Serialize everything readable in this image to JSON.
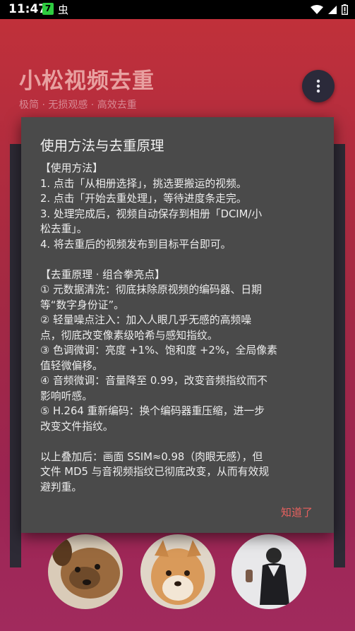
{
  "status_bar": {
    "time": "11:47",
    "badge": "7",
    "glyph": "虫"
  },
  "app": {
    "title": "小松视频去重",
    "subtitle": "极简 · 无损观感 · 高效去重"
  },
  "dialog": {
    "title": "使用方法与去重原理",
    "lines": [
      "【使用方法】",
      "1. 点击「从相册选择」，挑选要搬运的视频。",
      "2. 点击「开始去重处理」，等待进度条走完。",
      "3. 处理完成后，视频自动保存到相册「DCIM/小",
      "松去重」。",
      "4. 将去重后的视频发布到目标平台即可。",
      "",
      "【去重原理 · 组合拳亮点】",
      "① 元数据清洗：彻底抹除原视频的编码器、日期",
      "等“数字身份证”。",
      "② 轻量噪点注入：加入人眼几乎无感的高频噪",
      "点，彻底改变像素级哈希与感知指纹。",
      "③ 色调微调：亮度 +1%、饱和度 +2%，全局像素",
      "值轻微偏移。",
      "④ 音频微调：音量降至 0.99，改变音频指纹而不",
      "影响听感。",
      "⑤ H.264 重新编码：换个编码器重压缩，进一步",
      "改变文件指纹。",
      "",
      "以上叠加后：画面 SSIM≈0.98（肉眼无感），但",
      "文件 MD5 与音视频指纹已彻底改变，从而有效规",
      "避判重。"
    ],
    "ok_label": "知道了"
  },
  "colors": {
    "accent": "#e8615f",
    "dialog_bg": "#4a4a4a",
    "menu_button_bg": "#2b2a3a"
  }
}
